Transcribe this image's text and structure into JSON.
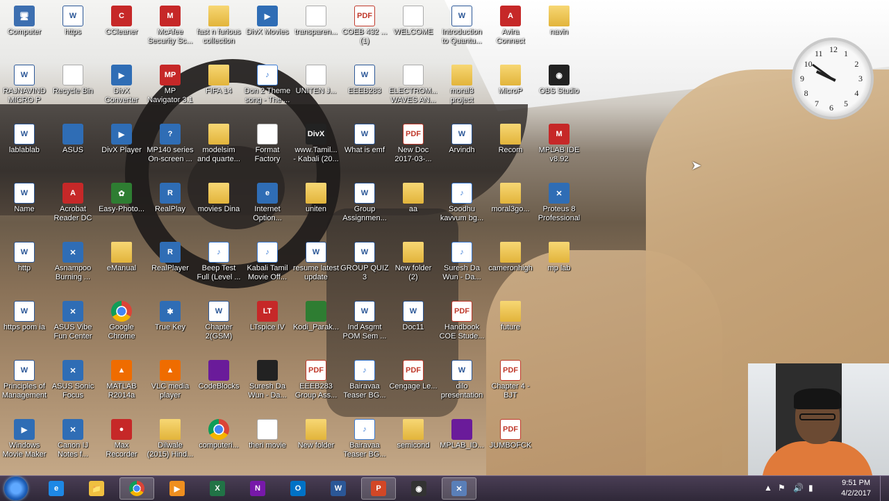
{
  "desktop": {
    "icons": [
      {
        "label": "Computer",
        "glyph": "🖥",
        "kind": "g-comp"
      },
      {
        "label": "https",
        "glyph": "W",
        "kind": "g-word"
      },
      {
        "label": "CCleaner",
        "glyph": "C",
        "kind": "g-red"
      },
      {
        "label": "McAfee\nSecurity Sc...",
        "glyph": "M",
        "kind": "g-red"
      },
      {
        "label": "fast n furious\ncollection",
        "glyph": "",
        "kind": "g-folder"
      },
      {
        "label": "DivX Movies",
        "glyph": "▶",
        "kind": "g-app"
      },
      {
        "label": "transparen...",
        "glyph": "",
        "kind": "g-blank"
      },
      {
        "label": "COEB 432 ...\n(1)",
        "glyph": "PDF",
        "kind": "g-pdf"
      },
      {
        "label": "WELCOME",
        "glyph": "",
        "kind": "g-blank"
      },
      {
        "label": "Introduction\nto Quantu...",
        "glyph": "W",
        "kind": "g-word"
      },
      {
        "label": "Avira\nConnect",
        "glyph": "A",
        "kind": "g-red"
      },
      {
        "label": "navin",
        "glyph": "",
        "kind": "g-folder"
      },
      {
        "label": "RAJNAVIND\nMICRO P",
        "glyph": "W",
        "kind": "g-word"
      },
      {
        "label": "Recycle Bin",
        "glyph": "🗑",
        "kind": "g-blank"
      },
      {
        "label": "DivX\nConverter",
        "glyph": "▶",
        "kind": "g-app"
      },
      {
        "label": "MP\nNavigator 3.1",
        "glyph": "MP",
        "kind": "g-red"
      },
      {
        "label": "FIFA 14",
        "glyph": "",
        "kind": "g-folder"
      },
      {
        "label": "Don 2 Theme\nsong - The ...",
        "glyph": "♪",
        "kind": "g-mp3"
      },
      {
        "label": "UNITEN J...",
        "glyph": "",
        "kind": "g-blank"
      },
      {
        "label": "EEEB283",
        "glyph": "W",
        "kind": "g-word"
      },
      {
        "label": "ELECTROM...\nWAVES AN...",
        "glyph": "",
        "kind": "g-blank"
      },
      {
        "label": "moral3\nproject",
        "glyph": "",
        "kind": "g-folder"
      },
      {
        "label": "MicroP",
        "glyph": "",
        "kind": "g-folder"
      },
      {
        "label": "OBS Studio",
        "glyph": "◉",
        "kind": "g-dark"
      },
      {
        "label": "lablablab",
        "glyph": "W",
        "kind": "g-word"
      },
      {
        "label": "ASUS",
        "glyph": "",
        "kind": "g-app"
      },
      {
        "label": "DivX Player",
        "glyph": "▶",
        "kind": "g-app"
      },
      {
        "label": "MP140 series\nOn-screen ...",
        "glyph": "?",
        "kind": "g-app"
      },
      {
        "label": "modelsim\nand quarte...",
        "glyph": "",
        "kind": "g-folder"
      },
      {
        "label": "Format\nFactory",
        "glyph": "F",
        "kind": "g-blank"
      },
      {
        "label": "www.Tamil...\n- Kabali (20...",
        "glyph": "DivX",
        "kind": "g-dark"
      },
      {
        "label": "What is emf",
        "glyph": "W",
        "kind": "g-word"
      },
      {
        "label": "New Doc\n2017-03-...",
        "glyph": "PDF",
        "kind": "g-pdf"
      },
      {
        "label": "Arvindh",
        "glyph": "W",
        "kind": "g-word"
      },
      {
        "label": "Recom",
        "glyph": "",
        "kind": "g-folder"
      },
      {
        "label": "MPLAB IDE\nv8.92",
        "glyph": "M",
        "kind": "g-red"
      },
      {
        "label": "Name",
        "glyph": "W",
        "kind": "g-word"
      },
      {
        "label": "Acrobat\nReader DC",
        "glyph": "A",
        "kind": "g-red"
      },
      {
        "label": "Easy-Photo...",
        "glyph": "✿",
        "kind": "g-green"
      },
      {
        "label": "RealPlay",
        "glyph": "R",
        "kind": "g-app"
      },
      {
        "label": "movies Dina",
        "glyph": "",
        "kind": "g-folder"
      },
      {
        "label": "Internet\nOption...",
        "glyph": "e",
        "kind": "g-app"
      },
      {
        "label": "uniten",
        "glyph": "",
        "kind": "g-folder"
      },
      {
        "label": "Group\nAssignmen...",
        "glyph": "W",
        "kind": "g-word"
      },
      {
        "label": "aa",
        "glyph": "",
        "kind": "g-folder"
      },
      {
        "label": "Soodhu\nkavvum bg...",
        "glyph": "♪",
        "kind": "g-mp3"
      },
      {
        "label": "moral3go...",
        "glyph": "",
        "kind": "g-folder"
      },
      {
        "label": "Proteus 8\nProfessional",
        "glyph": "✕",
        "kind": "g-app"
      },
      {
        "label": "http",
        "glyph": "W",
        "kind": "g-word"
      },
      {
        "label": "Asnampoo\nBurning ...",
        "glyph": "✕",
        "kind": "g-app"
      },
      {
        "label": "eManual",
        "glyph": "",
        "kind": "g-folder"
      },
      {
        "label": "RealPlayer",
        "glyph": "R",
        "kind": "g-app"
      },
      {
        "label": "Beep Test\nFull (Level ...",
        "glyph": "♪",
        "kind": "g-mp3"
      },
      {
        "label": "Kabali Tamil\nMovie  Off...",
        "glyph": "♪",
        "kind": "g-mp3"
      },
      {
        "label": "resume latest\nupdate",
        "glyph": "W",
        "kind": "g-word"
      },
      {
        "label": "GROUP QUIZ\n3",
        "glyph": "W",
        "kind": "g-word"
      },
      {
        "label": "New folder\n(2)",
        "glyph": "",
        "kind": "g-folder"
      },
      {
        "label": "Suresh Da\nWun - Da...",
        "glyph": "♪",
        "kind": "g-mp3"
      },
      {
        "label": "cameronhigh",
        "glyph": "",
        "kind": "g-folder"
      },
      {
        "label": "mp lab",
        "glyph": "",
        "kind": "g-folder"
      },
      {
        "label": "https pom ia",
        "glyph": "W",
        "kind": "g-word"
      },
      {
        "label": "ASUS Vibe\nFun Center",
        "glyph": "✕",
        "kind": "g-app"
      },
      {
        "label": "Google\nChrome",
        "glyph": "",
        "kind": "g-chrome"
      },
      {
        "label": "True Key",
        "glyph": "✱",
        "kind": "g-app"
      },
      {
        "label": "Chapter\n2(GSM)",
        "glyph": "W",
        "kind": "g-word"
      },
      {
        "label": "LTspice IV",
        "glyph": "LT",
        "kind": "g-red"
      },
      {
        "label": "Kodi_Parak...",
        "glyph": "",
        "kind": "g-green"
      },
      {
        "label": "Ind Asgmt\nPOM  Sem ...",
        "glyph": "W",
        "kind": "g-word"
      },
      {
        "label": "Doc11",
        "glyph": "W",
        "kind": "g-word"
      },
      {
        "label": "Handbook\nCOE Stude...",
        "glyph": "PDF",
        "kind": "g-pdf"
      },
      {
        "label": "future",
        "glyph": "",
        "kind": "g-folder"
      },
      {
        "label": "Principles of\nManagement",
        "glyph": "W",
        "kind": "g-word"
      },
      {
        "label": "ASUS Sonic\nFocus",
        "glyph": "✕",
        "kind": "g-app"
      },
      {
        "label": "MATLAB\nR2014a",
        "glyph": "▲",
        "kind": "g-orange"
      },
      {
        "label": "VLC media\nplayer",
        "glyph": "▲",
        "kind": "g-orange"
      },
      {
        "label": "CodeBlocks",
        "glyph": "",
        "kind": "g-purple"
      },
      {
        "label": "Suresh Da\nWun - Da...",
        "glyph": "",
        "kind": "g-dark"
      },
      {
        "label": "EEEB283\nGroup Ass...",
        "glyph": "PDF",
        "kind": "g-pdf"
      },
      {
        "label": "Bairavaa\nTeaser BG...",
        "glyph": "♪",
        "kind": "g-mp3"
      },
      {
        "label": "Cengage Le...",
        "glyph": "PDF",
        "kind": "g-pdf"
      },
      {
        "label": "dilo\npresentation",
        "glyph": "W",
        "kind": "g-word"
      },
      {
        "label": "Chapter 4 -\nBJT",
        "glyph": "PDF",
        "kind": "g-pdf"
      },
      {
        "label": "Windows\nMovie Maker",
        "glyph": "▶",
        "kind": "g-app"
      },
      {
        "label": "Canon IJ\nNotes f...",
        "glyph": "✕",
        "kind": "g-app"
      },
      {
        "label": "Max\nRecorder",
        "glyph": "●",
        "kind": "g-red"
      },
      {
        "label": "Dilwale\n(2015) Hind...",
        "glyph": "",
        "kind": "g-folder"
      },
      {
        "label": "computeri...",
        "glyph": "",
        "kind": "g-chrome"
      },
      {
        "label": "theri movie",
        "glyph": "",
        "kind": "g-blank"
      },
      {
        "label": "New folder",
        "glyph": "",
        "kind": "g-folder"
      },
      {
        "label": "Bairavaa\nTeaser BG...",
        "glyph": "♪",
        "kind": "g-mp3"
      },
      {
        "label": "semicond",
        "glyph": "",
        "kind": "g-folder"
      },
      {
        "label": "MPLAB_ID...",
        "glyph": "",
        "kind": "g-purple"
      },
      {
        "label": "JUMBOFCK",
        "glyph": "PDF",
        "kind": "g-pdf"
      }
    ]
  },
  "clock_gadget": {
    "numbers": [
      "12",
      "1",
      "2",
      "3",
      "4",
      "5",
      "6",
      "7",
      "8",
      "9",
      "10",
      "11"
    ],
    "time": "9:51"
  },
  "taskbar": {
    "buttons": [
      {
        "name": "internet-explorer-taskbar-button",
        "glyph": "e",
        "color": "#1e88e5",
        "active": false
      },
      {
        "name": "file-explorer-taskbar-button",
        "glyph": "📁",
        "color": "#f0c040",
        "active": false
      },
      {
        "name": "chrome-taskbar-button",
        "glyph": "",
        "color": "chrome",
        "active": true
      },
      {
        "name": "media-player-taskbar-button",
        "glyph": "▶",
        "color": "#ef8f1f",
        "active": false
      },
      {
        "name": "excel-taskbar-button",
        "glyph": "X",
        "color": "#217346",
        "active": false
      },
      {
        "name": "onenote-taskbar-button",
        "glyph": "N",
        "color": "#7719aa",
        "active": false
      },
      {
        "name": "outlook-taskbar-button",
        "glyph": "O",
        "color": "#0072c6",
        "active": false
      },
      {
        "name": "word-taskbar-button",
        "glyph": "W",
        "color": "#2b5797",
        "active": false
      },
      {
        "name": "powerpoint-taskbar-button",
        "glyph": "P",
        "color": "#d24726",
        "active": true
      },
      {
        "name": "obs-taskbar-button",
        "glyph": "◉",
        "color": "#333333",
        "active": false
      },
      {
        "name": "proteus-taskbar-button",
        "glyph": "✕",
        "color": "#5a7fb8",
        "active": true
      }
    ],
    "tray": {
      "time": "9:51 PM",
      "date": "4/2/2017"
    }
  }
}
